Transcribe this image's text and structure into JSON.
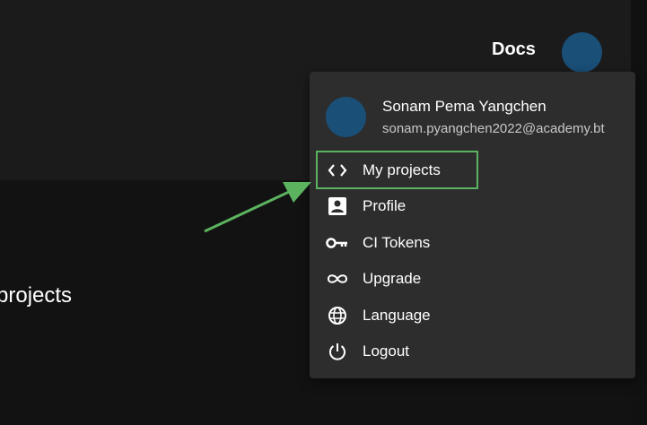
{
  "header": {
    "docs_label": "Docs"
  },
  "page": {
    "title": "projects"
  },
  "user_menu": {
    "name": "Sonam Pema Yangchen",
    "email": "sonam.pyangchen2022@academy.bt",
    "items": [
      {
        "label": "My projects",
        "icon": "code-icon"
      },
      {
        "label": "Profile",
        "icon": "profile-icon"
      },
      {
        "label": "CI Tokens",
        "icon": "key-icon"
      },
      {
        "label": "Upgrade",
        "icon": "infinity-icon"
      },
      {
        "label": "Language",
        "icon": "globe-icon"
      },
      {
        "label": "Logout",
        "icon": "power-icon"
      }
    ]
  },
  "colors": {
    "accent_annotation": "#5bb35f",
    "avatar": "#1a4f78",
    "menu_bg": "#2d2d2d"
  }
}
